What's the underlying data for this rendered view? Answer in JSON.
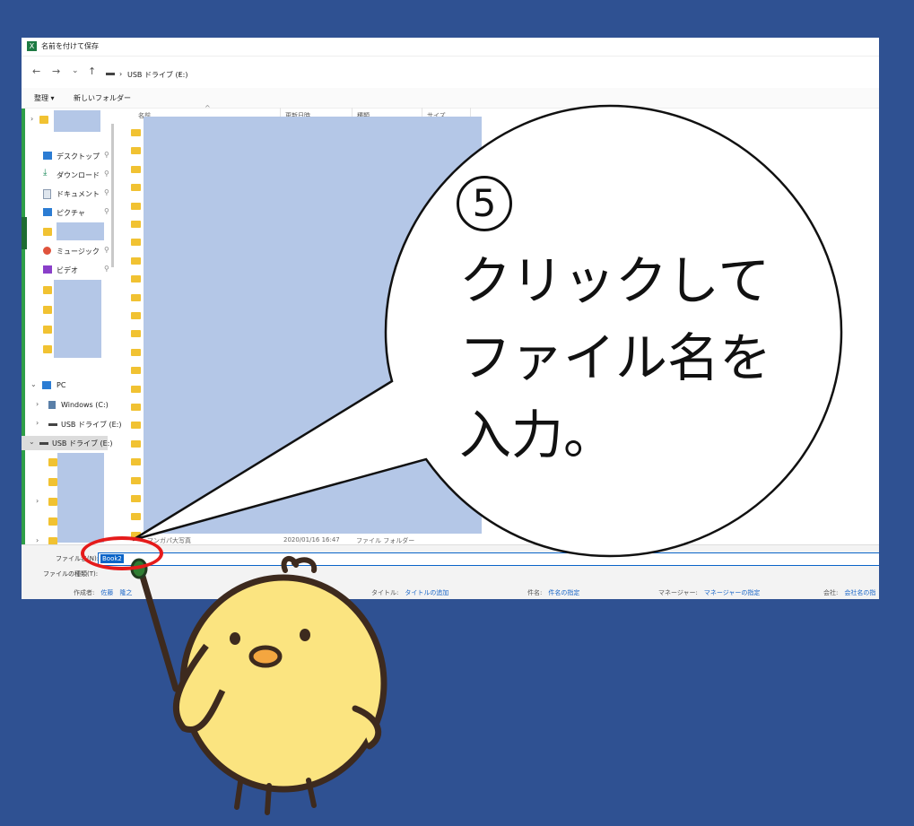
{
  "window": {
    "title": "名前を付けて保存",
    "app_icon": "excel-icon",
    "address": {
      "drive_icon": "usb-drive-icon",
      "path_separator": "›",
      "location": "USB ドライブ (E:)",
      "chevron": "›"
    },
    "nav": {
      "back": "←",
      "forward": "→",
      "recent": "⌄",
      "up": "↑"
    }
  },
  "command_bar": {
    "organize": "整理 ▾",
    "new_folder": "新しいフォルダー"
  },
  "sidebar": {
    "items": [
      {
        "label": "デスクトップ",
        "icon": "desktop-icon",
        "pin": "📌"
      },
      {
        "label": "ダウンロード",
        "icon": "download-icon",
        "pin": "📌"
      },
      {
        "label": "ドキュメント",
        "icon": "document-icon",
        "pin": "📌"
      },
      {
        "label": "ピクチャ",
        "icon": "picture-icon",
        "pin": "📌"
      },
      {
        "label": "ミュージック",
        "icon": "music-icon",
        "pin": "📌"
      },
      {
        "label": "ビデオ",
        "icon": "video-icon",
        "pin": "📌"
      }
    ],
    "pc": {
      "label": "PC",
      "icon": "pc-icon",
      "chevron": "⌄"
    },
    "drives": [
      {
        "label": "Windows (C:)",
        "icon": "windows-drive-icon",
        "chevron": "›"
      },
      {
        "label": "USB ドライブ (E:)",
        "icon": "usb-drive-icon",
        "chevron": "›"
      },
      {
        "label": "USB ドライブ (E:)",
        "icon": "usb-drive-icon",
        "chevron": "⌄"
      }
    ]
  },
  "file_list": {
    "columns": [
      "名前",
      "更新日時",
      "種類",
      "サイズ"
    ],
    "last_row": {
      "name": "マンガパ大写真",
      "date": "2020/01/16 16:47",
      "type": "ファイル フォルダー"
    }
  },
  "bottom": {
    "filename_label": "ファイル名(N):",
    "filename_value": "Book2",
    "filetype_label": "ファイルの種類(T):",
    "meta": [
      {
        "key": "作成者:",
        "value": "佐藤　隆之"
      },
      {
        "key": "タイトル:",
        "value": "タイトルの追加"
      },
      {
        "key": "件名:",
        "value": "件名の指定"
      },
      {
        "key": "マネージャー:",
        "value": "マネージャーの指定"
      },
      {
        "key": "会社:",
        "value": "会社名の指"
      }
    ]
  },
  "callout": {
    "number": "5",
    "lines": [
      "クリックして",
      "ファイル名を",
      "入力。"
    ]
  },
  "colors": {
    "background": "#2f5192",
    "accent": "#0a64c8",
    "highlight_ring": "#e51b1b",
    "redaction": "#b4c7e7"
  },
  "mascot": {
    "icon": "chick-pointer-icon"
  }
}
